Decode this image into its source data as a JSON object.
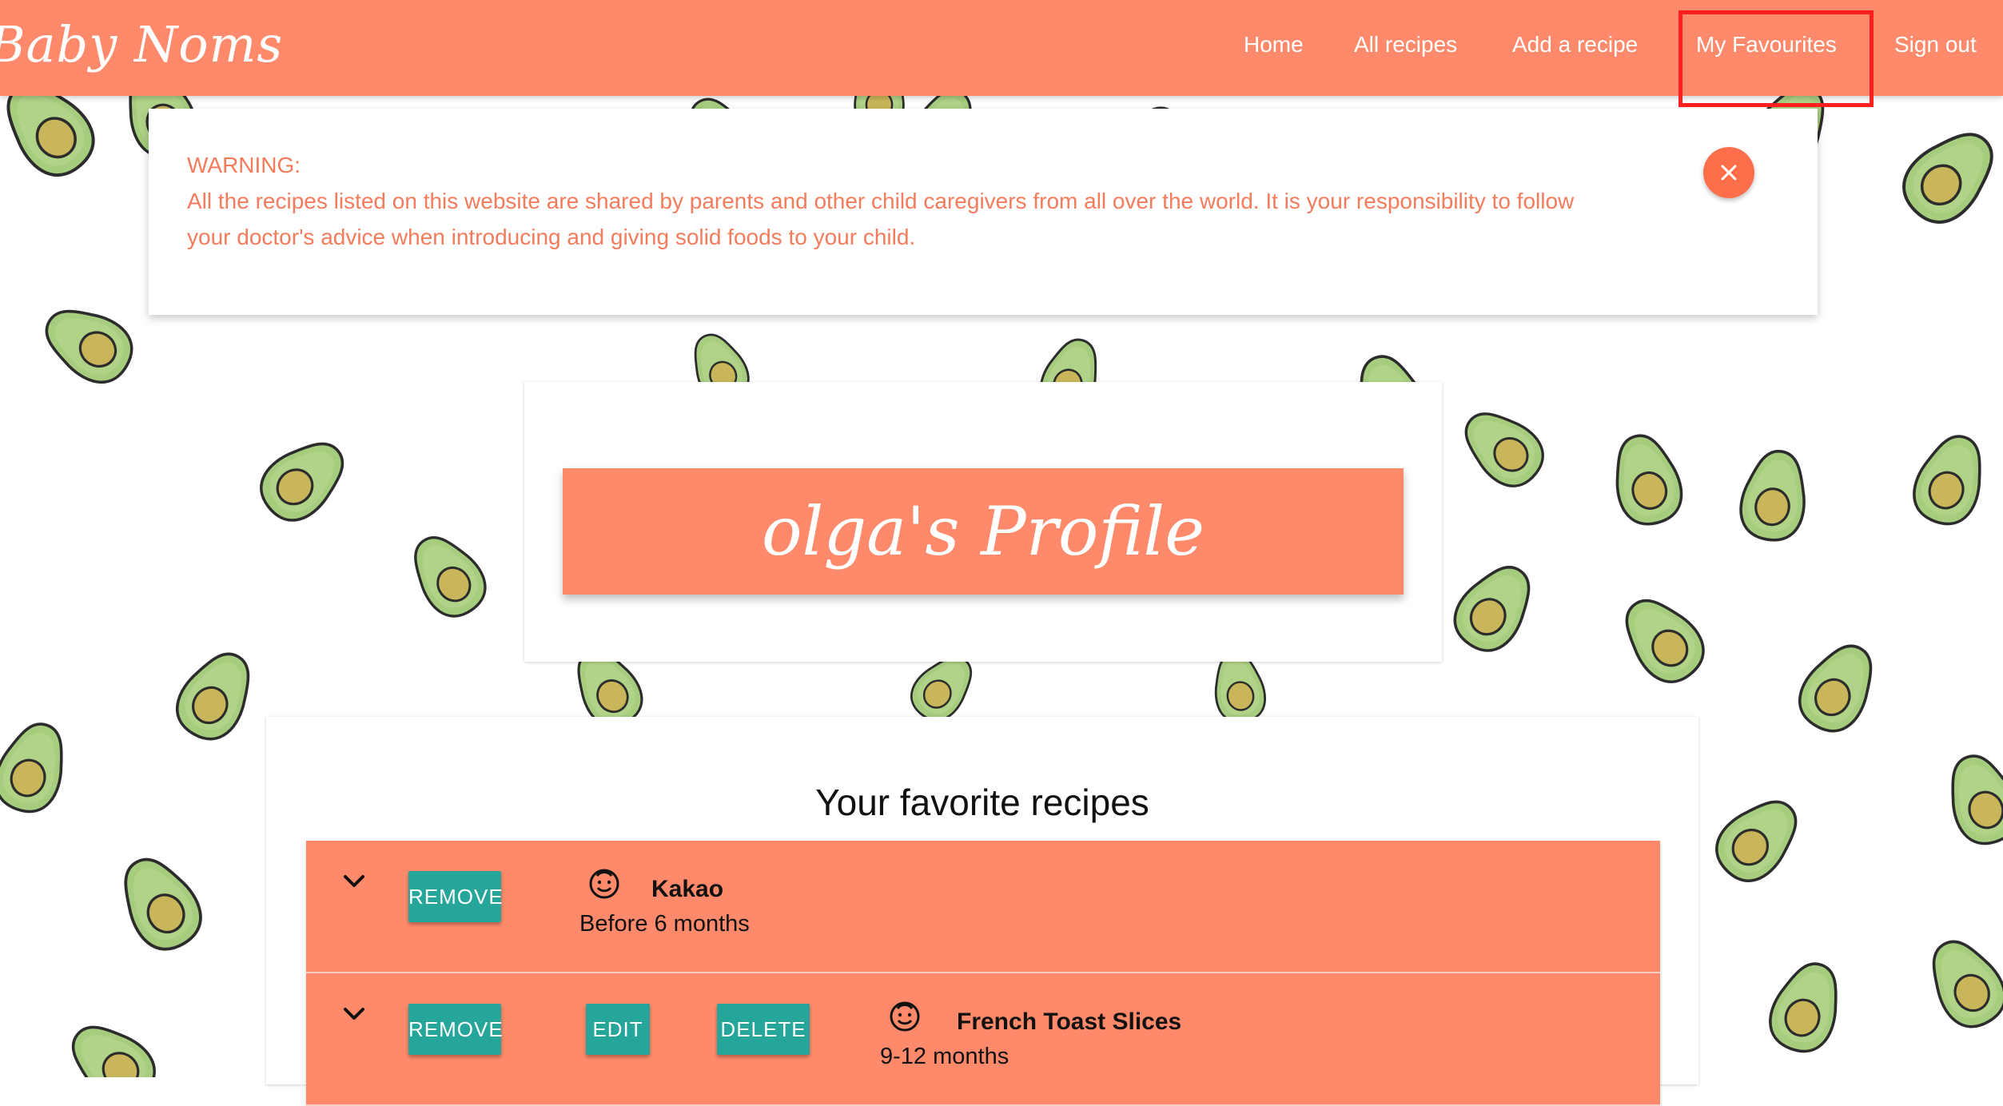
{
  "brand": "Baby Noms",
  "nav": {
    "items": [
      "Home",
      "All recipes",
      "Add a recipe",
      "My Favourites",
      "Sign out"
    ],
    "highlighted": "My Favourites"
  },
  "warning": {
    "heading": "WARNING:",
    "text": "All the recipes listed on this website are shared by parents and other child caregivers from all over the world. It is your responsibility to follow your doctor's advice when introducing and giving solid foods to your child.",
    "close_icon": "close-icon"
  },
  "profile": {
    "title": "olga's Profile"
  },
  "favorites": {
    "title": "Your favorite recipes",
    "recipes": [
      {
        "name": "Kakao",
        "age": "Before 6 months",
        "buttons": [
          "REMOVE"
        ],
        "icon": "baby-face-icon"
      },
      {
        "name": "French Toast Slices",
        "age": "9-12 months",
        "buttons": [
          "REMOVE",
          "EDIT",
          "DELETE"
        ],
        "icon": "baby-face-icon"
      }
    ]
  },
  "colors": {
    "brand": "#ff8a6b",
    "button": "#26a69a",
    "warning_text": "#f47b5b",
    "avocado_skin": "#a6cd7e",
    "avocado_pit": "#c9b65a",
    "highlight_box": "#ff1f1f"
  }
}
